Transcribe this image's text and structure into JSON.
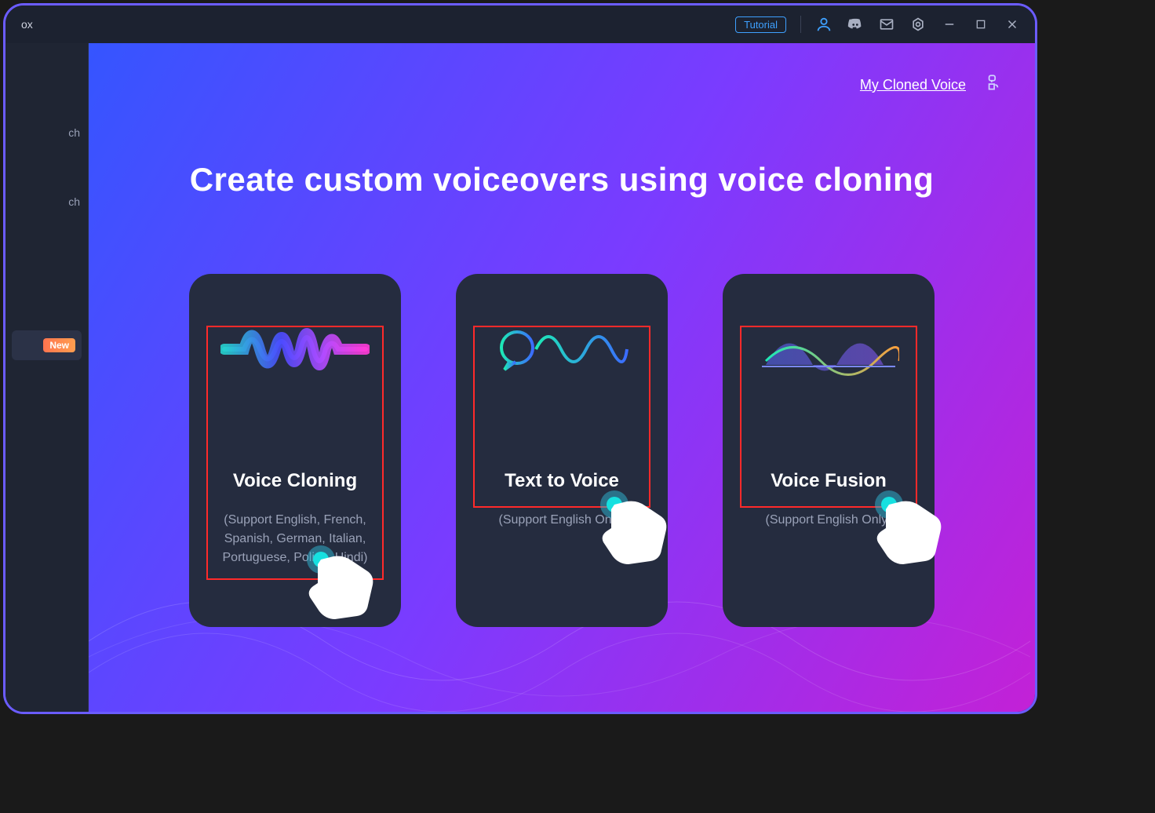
{
  "titlebar": {
    "title": "ox",
    "tutorial": "Tutorial"
  },
  "sidebar": {
    "item1": "ch",
    "item2": "ch",
    "badge": "New"
  },
  "header": {
    "my_cloned_voice": "My Cloned Voice",
    "headline": "Create custom voiceovers using voice cloning"
  },
  "cards": {
    "c1": {
      "title": "Voice Cloning",
      "sub": "(Support English, French, Spanish, German, Italian, Portuguese, Polish, Hindi)"
    },
    "c2": {
      "title": "Text to Voice",
      "sub": "(Support English Only)"
    },
    "c3": {
      "title": "Voice Fusion",
      "sub": "(Support English Only)"
    }
  }
}
